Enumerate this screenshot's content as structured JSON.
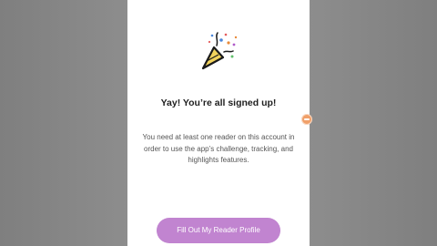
{
  "signup": {
    "title": "Yay! You’re all signed up!",
    "message": "You need at least one reader on this account in order to use the app’s challenge, tracking, and highlights features.",
    "cta_label": "Fill Out My Reader Profile"
  },
  "icons": {
    "hero": "party-popper-icon",
    "edge": "assistant-bubble-icon"
  },
  "colors": {
    "accent": "#c184d0",
    "popper_fill": "#f2d35c"
  }
}
